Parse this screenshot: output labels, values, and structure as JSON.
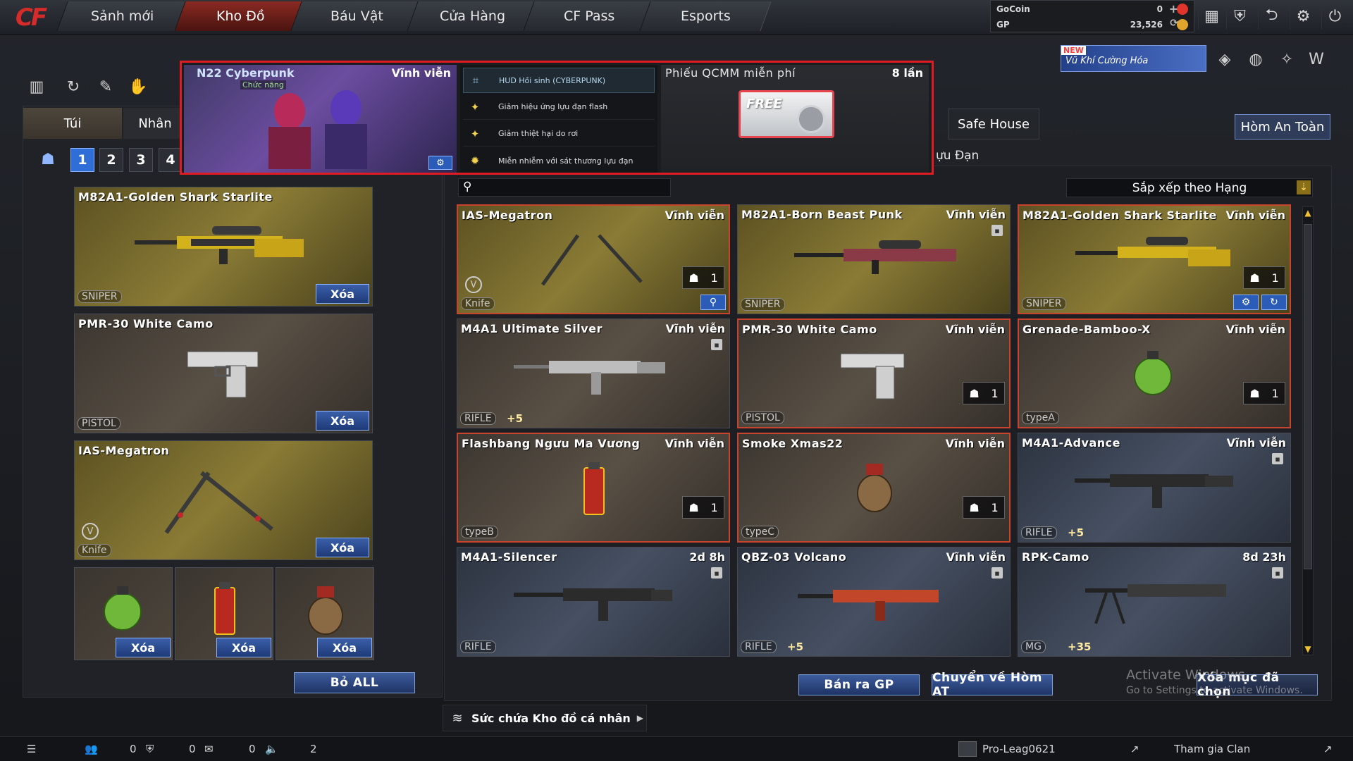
{
  "nav": {
    "tabs": [
      "Sảnh mới",
      "Kho Đồ",
      "Báu Vật",
      "Cửa Hàng",
      "CF Pass",
      "Esports"
    ],
    "active": "Kho Đồ"
  },
  "currency": {
    "gocoin_label": "GoCoin",
    "gocoin_value": "0",
    "gp_label": "GP",
    "gp_value": "23,526"
  },
  "banner": {
    "new_tag": "NEW",
    "text": "Vũ Khí Cường Hóa"
  },
  "left": {
    "tabs": [
      "Túi",
      "Nhân"
    ],
    "pages": [
      "1",
      "2",
      "3",
      "4"
    ],
    "cards": [
      {
        "name": "M82A1-Golden Shark Starlite",
        "type": "SNIPER",
        "action": "Xóa"
      },
      {
        "name": "PMR-30 White Camo",
        "type": "PISTOL",
        "action": "Xóa"
      },
      {
        "name": "IAS-Megatron",
        "type": "Knife",
        "action": "Xóa"
      }
    ],
    "slots": [
      "Xóa",
      "Xóa",
      "Xóa"
    ],
    "remove_all": "Bỏ ALL"
  },
  "right": {
    "tabs": [
      "Safe House",
      "Hòm An Toàn"
    ],
    "subtitle": "ựu Đạn",
    "sort_label": "Sắp xếp theo Hạng",
    "items": [
      {
        "name": "IAS-Megatron",
        "duration": "Vĩnh viễn",
        "type": "Knife",
        "count": "1"
      },
      {
        "name": "M82A1-Born Beast Punk",
        "duration": "Vĩnh viễn",
        "type": "SNIPER"
      },
      {
        "name": "M82A1-Golden Shark Starlite",
        "duration": "Vĩnh viễn",
        "type": "SNIPER",
        "count": "1"
      },
      {
        "name": "M4A1 Ultimate Silver",
        "duration": "Vĩnh viễn",
        "type": "RIFLE",
        "extra": "+5"
      },
      {
        "name": "PMR-30 White Camo",
        "duration": "Vĩnh viễn",
        "type": "PISTOL",
        "count": "1"
      },
      {
        "name": "Grenade-Bamboo-X",
        "duration": "Vĩnh viễn",
        "type": "typeA",
        "count": "1"
      },
      {
        "name": "Flashbang Ngưu Ma Vương",
        "duration": "Vĩnh viễn",
        "type": "typeB",
        "count": "1"
      },
      {
        "name": "Smoke Xmas22",
        "duration": "Vĩnh viễn",
        "type": "typeC",
        "count": "1"
      },
      {
        "name": "M4A1-Advance",
        "duration": "Vĩnh viễn",
        "type": "RIFLE",
        "extra": "+5"
      },
      {
        "name": "M4A1-Silencer",
        "duration": "2d 8h",
        "type": "RIFLE"
      },
      {
        "name": "QBZ-03 Volcano",
        "duration": "Vĩnh viễn",
        "type": "RIFLE",
        "extra": "+5"
      },
      {
        "name": "RPK-Camo",
        "duration": "8d 23h",
        "type": "MG",
        "extra": "+35"
      }
    ],
    "sell_button": "Bán ra GP",
    "transfer_button": "Chuyển về Hòm AT",
    "delete_selected": "Xóa mục đã chọn"
  },
  "tooltip": {
    "char_name": "N22 Cyberpunk",
    "char_tag": "Chức năng",
    "char_duration": "Vĩnh viễn",
    "features": [
      "HUD Hồi sinh (CYBERPUNK)",
      "Giảm hiệu ứng lựu đạn flash",
      "Giảm thiệt hại do rơi",
      "Miễn nhiễm với sát thương lựu đạn"
    ],
    "coupon_title": "Phiếu QCMM miễn phí",
    "coupon_count": "8 lần",
    "coupon_label": "FREE"
  },
  "storage": {
    "label": "Sức chứa Kho đồ cá nhân"
  },
  "bottom": {
    "count1": "0",
    "count2": "0",
    "count3": "0",
    "count4": "2",
    "user": "Pro-Leag0621",
    "clan": "Tham gia Clan"
  },
  "watermark": {
    "line1": "Activate Windows",
    "line2": "Go to Settings to activate Windows."
  },
  "colors": {
    "accent_red": "#e01b24",
    "button_blue": "#2a5cb8",
    "gold_card": "#8a7b35"
  }
}
